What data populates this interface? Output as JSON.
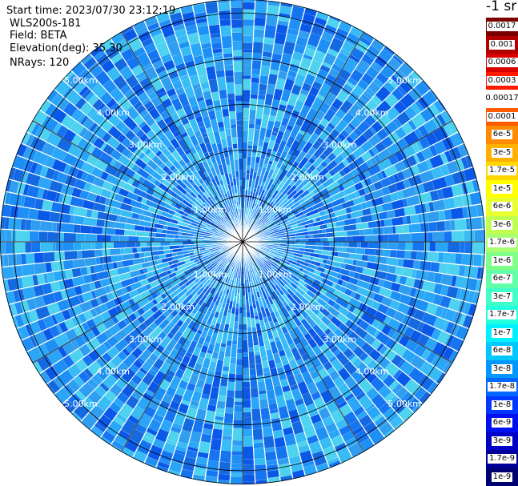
{
  "info": {
    "start_time": "Start time: 2023/07/30 23:12:19",
    "site": "WLS200s-181",
    "field": "Field: BETA",
    "elevation": "Elevation(deg): 35.30",
    "nrays": "NRays: 120"
  },
  "chart_data": {
    "type": "heatmap",
    "projection": "polar-ppi",
    "field": "BETA",
    "elevation_deg": 35.3,
    "n_rays": 120,
    "max_range_km": 5.3,
    "range_rings_km": [
      1,
      2,
      3,
      4,
      5
    ],
    "range_ring_label": "{r}.00km",
    "colorbar": {
      "title": "-1 sr",
      "scale": "log",
      "ticks": [
        "0.0017",
        "0.001",
        "0.0006",
        "0.0003",
        "0.00017",
        "0.0001",
        "6e-5",
        "3e-5",
        "1.7e-5",
        "1e-5",
        "6e-6",
        "3e-6",
        "1.7e-6",
        "1e-6",
        "6e-7",
        "3e-7",
        "1.7e-7",
        "1e-7",
        "6e-8",
        "3e-8",
        "1.7e-8",
        "1e-8",
        "6e-9",
        "3e-9",
        "1.7e-9",
        "1e-9"
      ],
      "colors": [
        "#7a0000",
        "#b00000",
        "#d80000",
        "#ff1a00",
        "#ffffff",
        "#ff5a00",
        "#ff8c00",
        "#ffb000",
        "#ffd700",
        "#ffff00",
        "#e8ff30",
        "#c0ff50",
        "#a8ff70",
        "#80ff88",
        "#60ffa8",
        "#40ffc8",
        "#20ffe0",
        "#00f0ff",
        "#00c8ff",
        "#0098ff",
        "#0068ff",
        "#0038ff",
        "#0010f0",
        "#0000c8",
        "#000098",
        "#000070"
      ]
    }
  }
}
